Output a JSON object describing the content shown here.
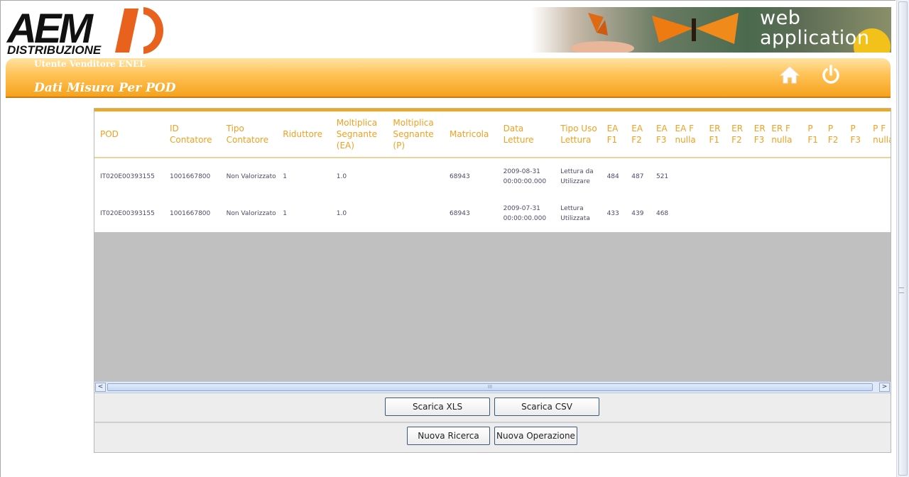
{
  "header": {
    "logo_top": "AEM",
    "logo_bottom": "DISTRIBUZIONE",
    "logo_mark": "D",
    "banner_line1": "web",
    "banner_line2": "application",
    "user_label": "Utente Venditore ENEL",
    "page_title": "Dati Misura Per POD",
    "home_icon": "home-icon",
    "power_icon": "power-icon"
  },
  "table": {
    "columns": [
      "POD",
      "ID Contatore",
      "Tipo Contatore",
      "Riduttore",
      "Moltiplica Segnante (EA)",
      "Moltiplica Segnante (P)",
      "Matricola",
      "Data Letture",
      "Tipo Uso Lettura",
      "EA F1",
      "EA F2",
      "EA F3",
      "EA F nulla",
      "ER F1",
      "ER F2",
      "ER F3",
      "ER F nulla",
      "P F1",
      "P F2",
      "P F3",
      "P F nulla"
    ],
    "rows": [
      [
        "IT020E00393155",
        "1001667800",
        "Non Valorizzato",
        "1",
        "1.0",
        "",
        "68943",
        "2009-08-31 00:00:00.000",
        "Lettura da Utilizzare",
        "484",
        "487",
        "521",
        "",
        "",
        "",
        "",
        "",
        "",
        "",
        "",
        ""
      ],
      [
        "IT020E00393155",
        "1001667800",
        "Non Valorizzato",
        "1",
        "1.0",
        "",
        "68943",
        "2009-07-31 00:00:00.000",
        "Lettura Utilizzata",
        "433",
        "439",
        "468",
        "",
        "",
        "",
        "",
        "",
        "",
        "",
        "",
        ""
      ]
    ]
  },
  "scrollbar": {
    "left_arrow": "<",
    "right_arrow": ">",
    "grip": "III"
  },
  "buttons": {
    "scarica_xls": "Scarica XLS",
    "scarica_csv": "Scarica CSV",
    "nuova_ricerca": "Nuova Ricerca",
    "nuova_operazione": "Nuova Operazione"
  },
  "colors": {
    "accent_orange": "#f6a21c",
    "header_text": "#f0a020",
    "cell_text": "#4a4a6a"
  }
}
